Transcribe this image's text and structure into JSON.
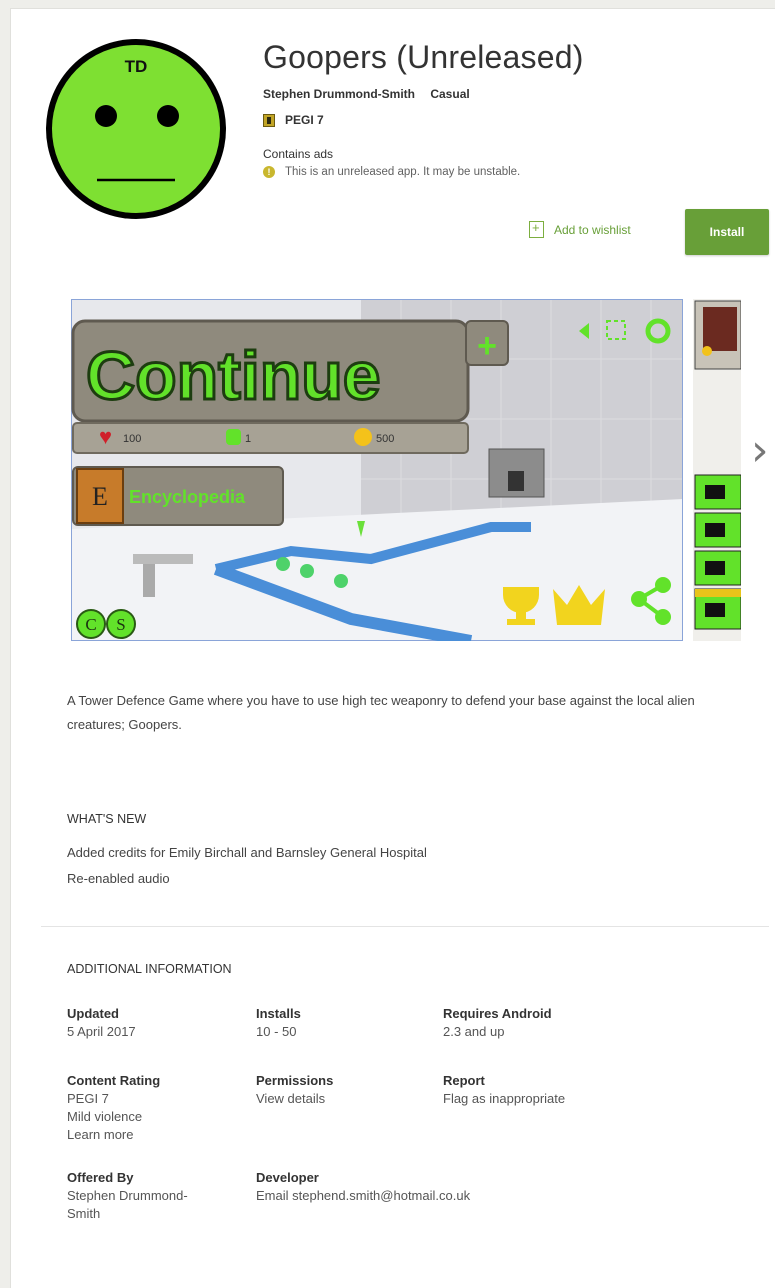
{
  "app": {
    "title": "Goopers (Unreleased)",
    "developer": "Stephen Drummond-Smith",
    "category": "Casual",
    "rating_badge": "PEGI 7",
    "contains_ads": "Contains ads",
    "warning": "This is an unreleased app. It may be unstable.",
    "wishlist_label": "Add to wishlist",
    "install_label": "Install",
    "icon_text": "TD"
  },
  "screenshot": {
    "continue_label": "Continue",
    "encyclopedia_label": "Encyclopedia",
    "encyclopedia_letter": "E",
    "plus": "+",
    "hearts": "100",
    "goopers": "1",
    "coins": "500",
    "c_button": "C",
    "s_button": "S"
  },
  "description": "A Tower Defence Game where you have to use high tec weaponry to defend your base against the local alien creatures; Goopers.",
  "whats_new": {
    "heading": "WHAT'S NEW",
    "lines": [
      "Added credits for Emily Birchall and Barnsley General Hospital",
      "Re-enabled audio"
    ]
  },
  "additional_info": {
    "heading": "ADDITIONAL INFORMATION",
    "updated": {
      "label": "Updated",
      "value": "5 April 2017"
    },
    "installs": {
      "label": "Installs",
      "value": "10 - 50"
    },
    "requires": {
      "label": "Requires Android",
      "value": "2.3 and up"
    },
    "content_rating": {
      "label": "Content Rating",
      "value": "PEGI 7",
      "detail": "Mild violence",
      "link": "Learn more"
    },
    "permissions": {
      "label": "Permissions",
      "link": "View details"
    },
    "report": {
      "label": "Report",
      "link": "Flag as inappropriate"
    },
    "offered_by": {
      "label": "Offered By",
      "value_line1": "Stephen Drummond-",
      "value_line2": "Smith"
    },
    "developer": {
      "label": "Developer",
      "link": "Email stephend.smith@hotmail.co.uk"
    }
  },
  "colors": {
    "accent": "#689f38",
    "icon_green": "#7ee032",
    "ui_green": "#62e22a"
  }
}
